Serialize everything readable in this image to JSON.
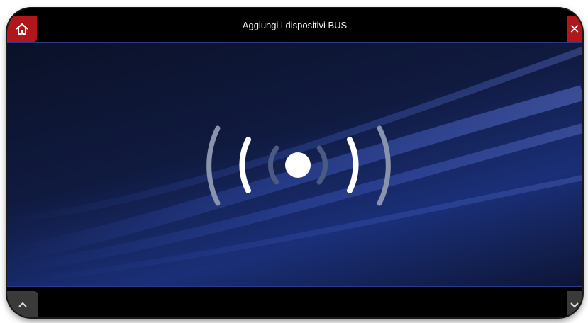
{
  "header": {
    "title": "Aggiungi i dispositivi BUS",
    "home_icon": "home-icon",
    "close_icon": "close-icon"
  },
  "main": {
    "indicator_icon": "wireless-signal-icon"
  },
  "footer": {
    "left_icon": "chevron-up-icon",
    "right_icon": "chevron-down-icon"
  },
  "colors": {
    "accent_red": "#b0171a",
    "bar_black": "#000000",
    "background_blue": "#1a2f78"
  }
}
